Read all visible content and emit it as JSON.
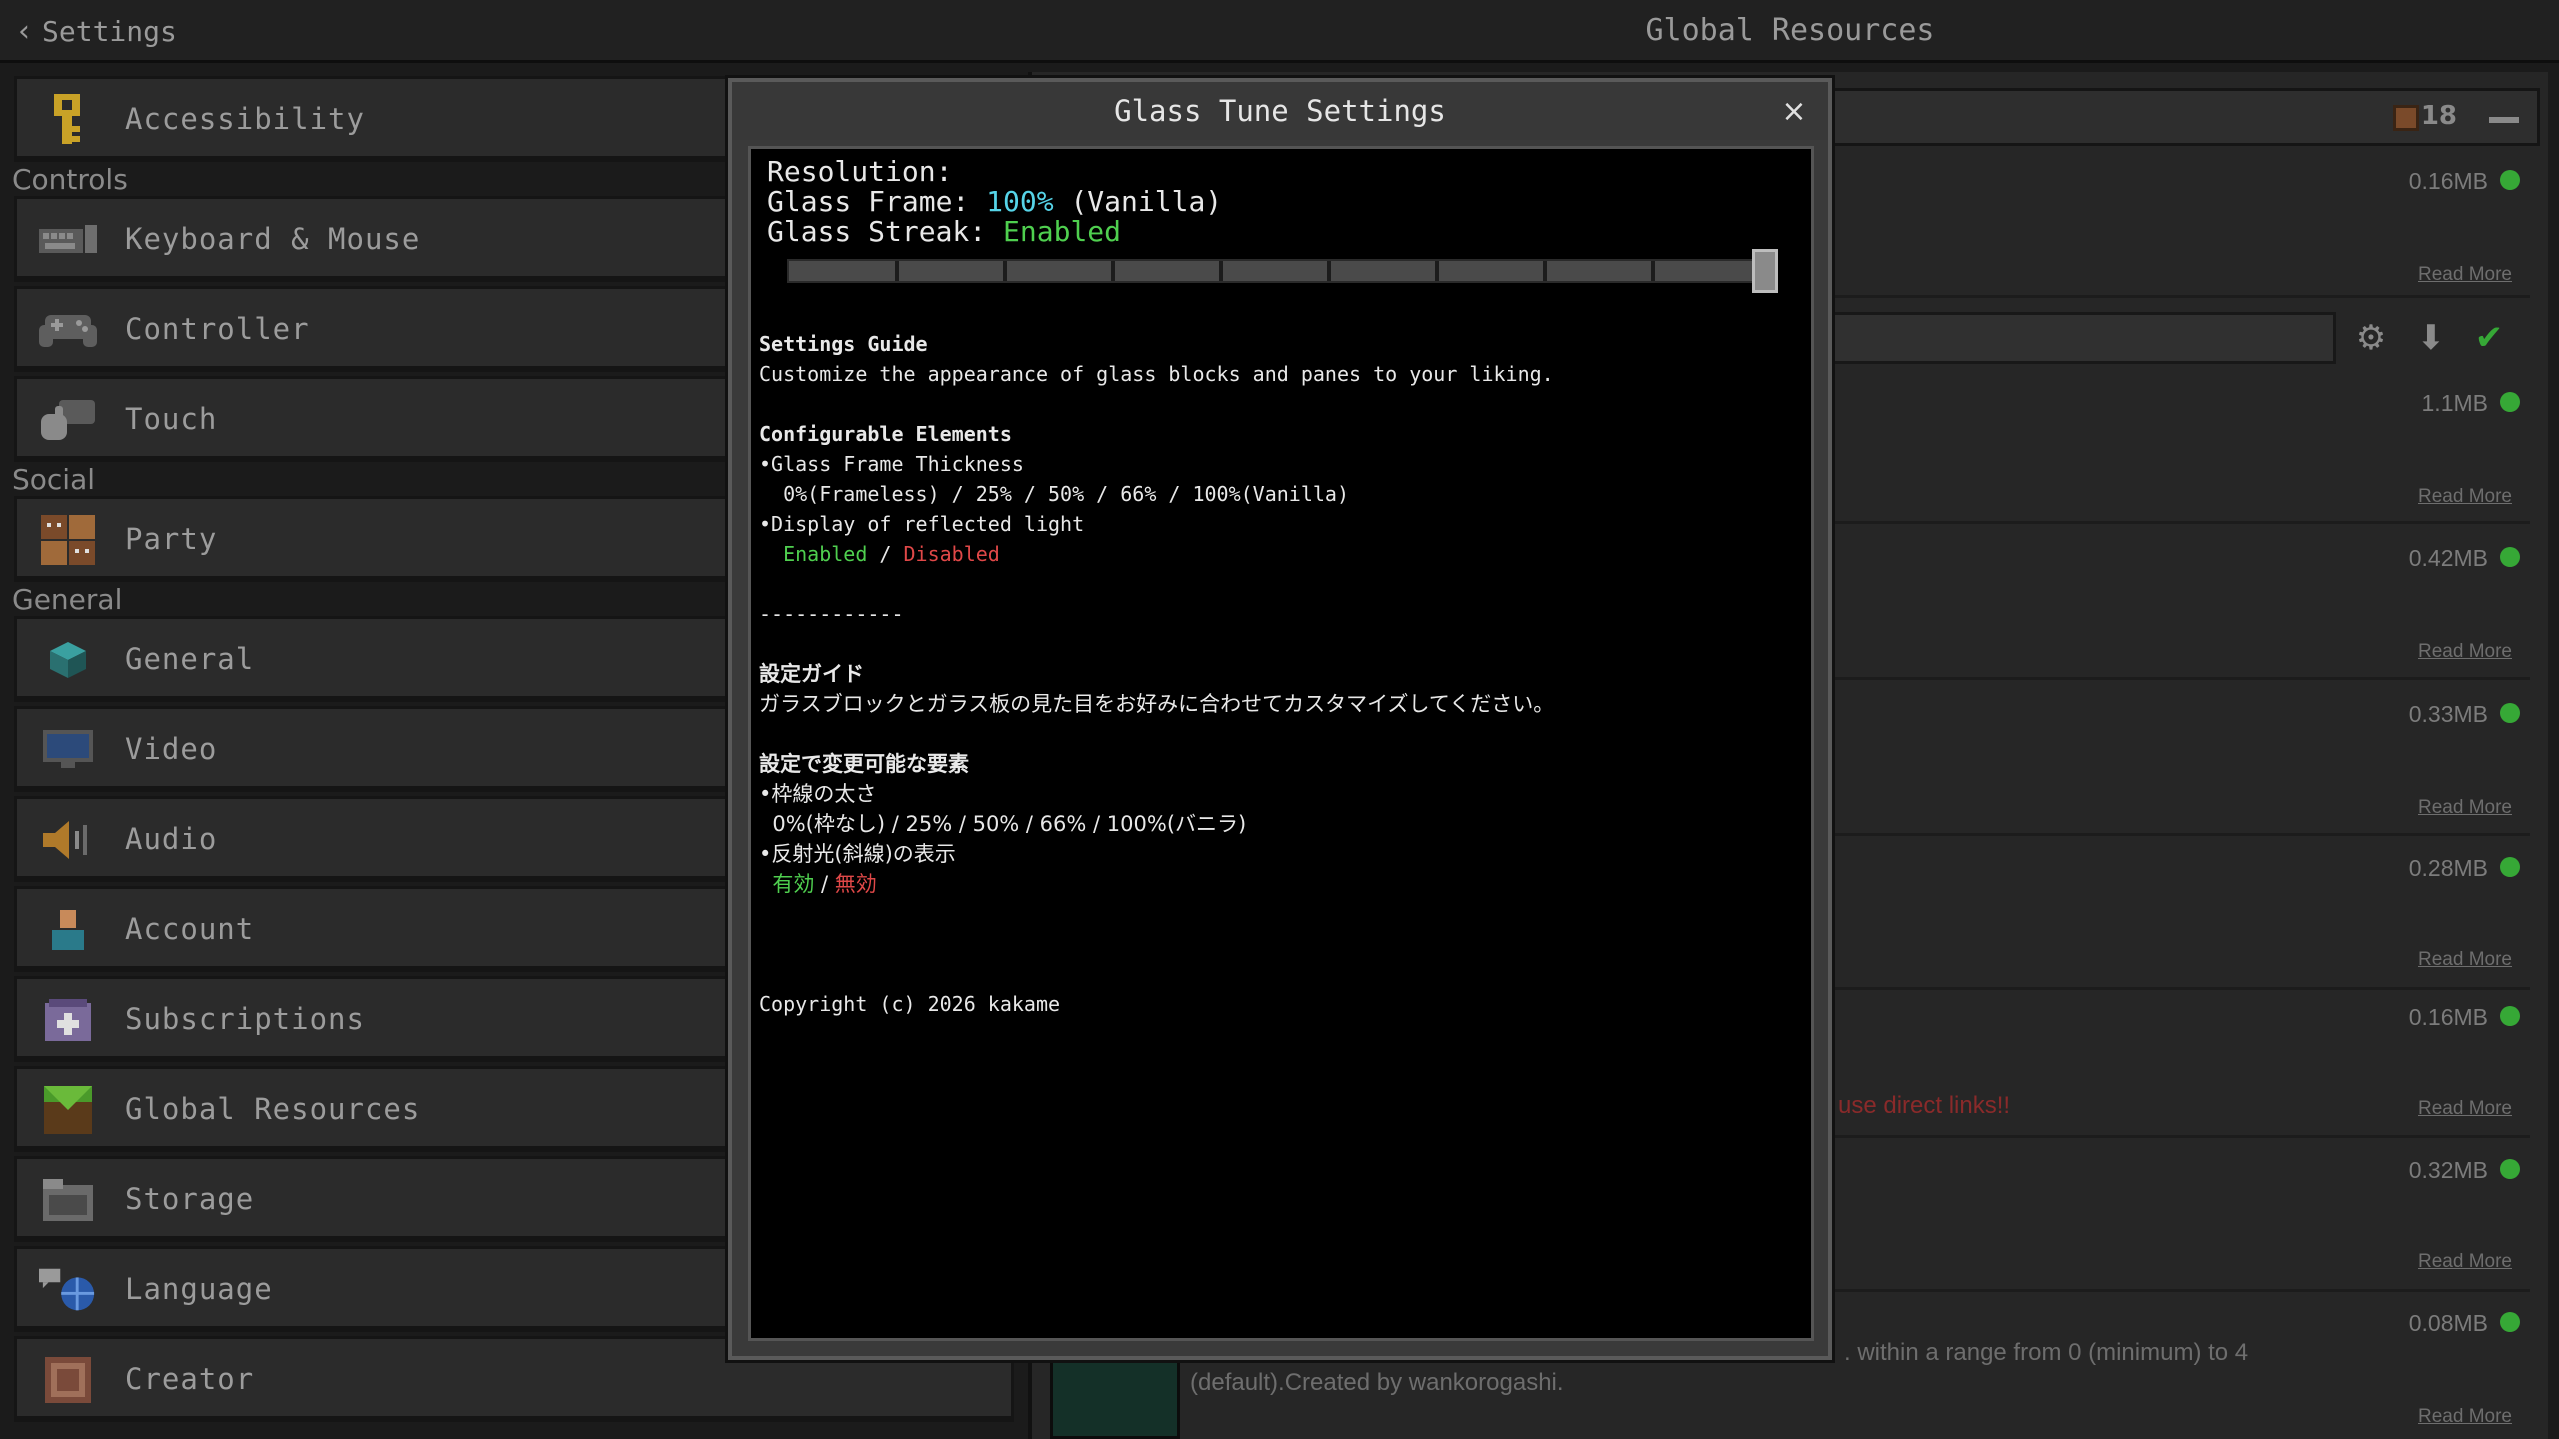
{
  "topbar": {
    "back_label": "Settings",
    "title": "Global Resources"
  },
  "sidebar": {
    "sections": {
      "controls": "Controls",
      "social": "Social",
      "general": "General"
    },
    "items": [
      {
        "label": "Accessibility",
        "icon": "key-icon"
      },
      {
        "label": "Keyboard & Mouse",
        "icon": "keyboard-icon"
      },
      {
        "label": "Controller",
        "icon": "gamepad-icon"
      },
      {
        "label": "Touch",
        "icon": "hand-icon"
      },
      {
        "label": "Party",
        "icon": "party-icon"
      },
      {
        "label": "General",
        "icon": "cube-icon"
      },
      {
        "label": "Video",
        "icon": "monitor-icon"
      },
      {
        "label": "Audio",
        "icon": "speaker-icon"
      },
      {
        "label": "Account",
        "icon": "user-icon"
      },
      {
        "label": "Subscriptions",
        "icon": "plus-box-icon"
      },
      {
        "label": "Global Resources",
        "icon": "grass-block-icon"
      },
      {
        "label": "Storage",
        "icon": "folder-icon"
      },
      {
        "label": "Language",
        "icon": "globe-icon"
      },
      {
        "label": "Creator",
        "icon": "creator-icon"
      }
    ]
  },
  "resources": {
    "pack_count": "18",
    "rows": [
      {
        "size": "0.16MB",
        "more": "Read More"
      },
      {
        "size": "1.1MB",
        "more": "Read More"
      },
      {
        "size": "0.42MB",
        "more": "Read More"
      },
      {
        "size": "0.33MB",
        "more": "Read More"
      },
      {
        "size": "0.28MB",
        "more": "Read More"
      },
      {
        "size": "0.16MB",
        "more": "Read More"
      },
      {
        "size": "0.32MB",
        "more": "Read More"
      },
      {
        "size": "0.08MB",
        "more": "Read More"
      }
    ],
    "warning_text": "use direct links!!",
    "desc_line1": ". within a range from 0 (minimum) to 4",
    "desc_line2": "(default).Created by wankorogashi."
  },
  "modal": {
    "title": "Glass Tune Settings",
    "close_glyph": "×",
    "resolution_label": "Resolution:",
    "frame_label": "Glass Frame: ",
    "frame_value": "100%",
    "frame_suffix": " (Vanilla)",
    "streak_label": "Glass Streak: ",
    "streak_value": "Enabled",
    "slider_value": 1.0,
    "guide_title": "Settings Guide",
    "guide_text": "Customize the appearance of glass blocks and panes to your liking.",
    "elements_title": "Configurable Elements",
    "el1": "•Glass Frame Thickness",
    "el1_opts": "  0%(Frameless) / 25% / 50% / 66% / 100%(Vanilla)",
    "el2": "•Display of reflected light",
    "el2_on": "Enabled",
    "el2_sep": " / ",
    "el2_off": "Disabled",
    "divider": "------------",
    "jp_guide_title": "設定ガイド",
    "jp_guide_text": "ガラスブロックとガラス板の見た目をお好みに合わせてカスタマイズしてください。",
    "jp_elements_title": "設定で変更可能な要素",
    "jp_el1": "•枠線の太さ",
    "jp_el1_opts": "  0%(枠なし) / 25% / 50% / 66% / 100%(バニラ)",
    "jp_el2": "•反射光(斜線)の表示",
    "jp_el2_on": "有効",
    "jp_el2_sep": " / ",
    "jp_el2_off": "無効",
    "copyright": "Copyright (c) 2026 kakame"
  }
}
